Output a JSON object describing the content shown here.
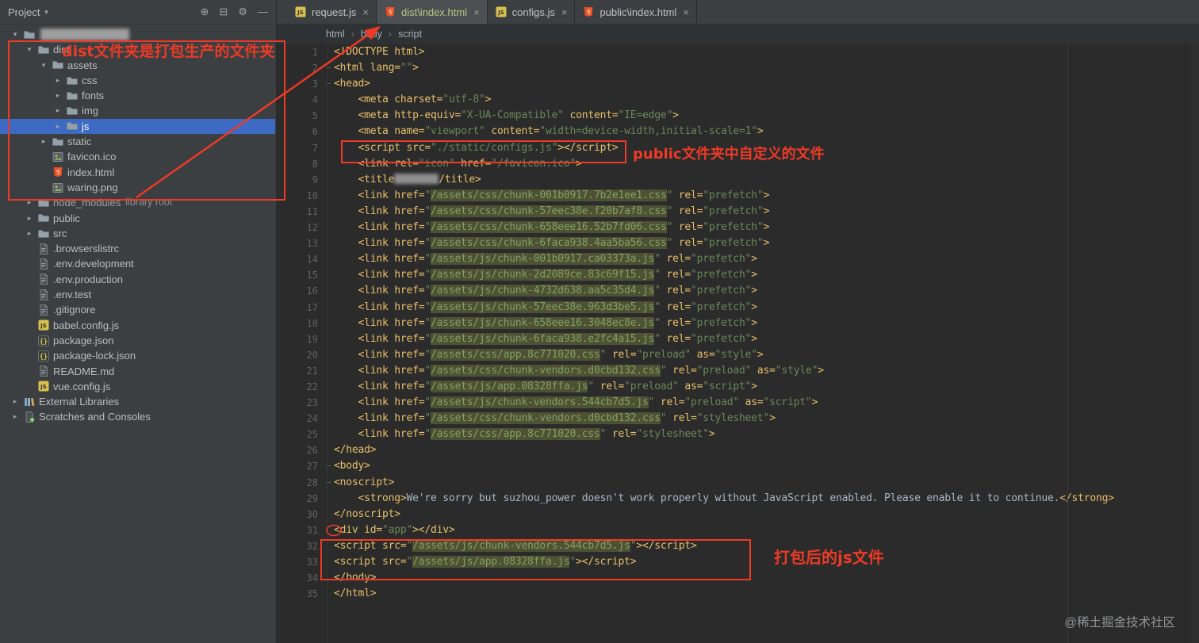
{
  "colors": {
    "annotation_red": "#ee3a26",
    "selection_blue": "#3d6ac2",
    "highlight_olive": "#4e5133",
    "tab_active_label": "#b4c882"
  },
  "project_panel": {
    "title": "Project",
    "title_caret": "▼",
    "toolbar": [
      {
        "name": "locate-file",
        "glyph": "⊕"
      },
      {
        "name": "collapse-all",
        "glyph": "⊟"
      },
      {
        "name": "settings",
        "glyph": "⚙"
      },
      {
        "name": "hide-panel",
        "glyph": "—"
      }
    ],
    "tree": [
      {
        "name": "project-root",
        "label": "",
        "icon": "folder",
        "indent": 0,
        "arrow": "down",
        "censored": true
      },
      {
        "label": "dist",
        "icon": "folder",
        "indent": 1,
        "arrow": "down"
      },
      {
        "label": "assets",
        "icon": "folder",
        "indent": 2,
        "arrow": "down"
      },
      {
        "label": "css",
        "icon": "folder",
        "indent": 3,
        "arrow": "right"
      },
      {
        "label": "fonts",
        "icon": "folder",
        "indent": 3,
        "arrow": "right"
      },
      {
        "label": "img",
        "icon": "folder",
        "indent": 3,
        "arrow": "right"
      },
      {
        "label": "js",
        "icon": "folder",
        "indent": 3,
        "arrow": "right",
        "selected": true
      },
      {
        "label": "static",
        "icon": "folder",
        "indent": 2,
        "arrow": "right"
      },
      {
        "label": "favicon.ico",
        "icon": "image",
        "indent": 2,
        "file": true
      },
      {
        "label": "index.html",
        "icon": "html",
        "indent": 2,
        "file": true
      },
      {
        "label": "waring.png",
        "icon": "image",
        "indent": 2,
        "file": true
      },
      {
        "label": "node_modules",
        "suffix": "library root",
        "icon": "folder",
        "indent": 1,
        "arrow": "right",
        "dim": true
      },
      {
        "label": "public",
        "icon": "folder",
        "indent": 1,
        "arrow": "right"
      },
      {
        "label": "src",
        "icon": "folder",
        "indent": 1,
        "arrow": "right"
      },
      {
        "label": ".browserslistrc",
        "icon": "text",
        "indent": 1,
        "file": true
      },
      {
        "label": ".env.development",
        "icon": "text",
        "indent": 1,
        "file": true
      },
      {
        "label": ".env.production",
        "icon": "text",
        "indent": 1,
        "file": true
      },
      {
        "label": ".env.test",
        "icon": "text",
        "indent": 1,
        "file": true
      },
      {
        "label": ".gitignore",
        "icon": "text",
        "indent": 1,
        "file": true
      },
      {
        "label": "babel.config.js",
        "icon": "js",
        "indent": 1,
        "file": true
      },
      {
        "label": "package.json",
        "icon": "json",
        "indent": 1,
        "file": true
      },
      {
        "label": "package-lock.json",
        "icon": "json",
        "indent": 1,
        "file": true
      },
      {
        "label": "README.md",
        "icon": "text",
        "indent": 1,
        "file": true
      },
      {
        "label": "vue.config.js",
        "icon": "js",
        "indent": 1,
        "file": true
      },
      {
        "label": "External Libraries",
        "icon": "lib",
        "indent": 0,
        "arrow": "right"
      },
      {
        "label": "Scratches and Consoles",
        "icon": "scratch",
        "indent": 0,
        "arrow": "right"
      }
    ]
  },
  "tab_bar": {
    "close_glyph": "×",
    "tabs": [
      {
        "label": "request.js",
        "icon": "js",
        "active": false
      },
      {
        "label": "dist\\index.html",
        "icon": "html",
        "active": true
      },
      {
        "label": "configs.js",
        "icon": "js",
        "active": false
      },
      {
        "label": "public\\index.html",
        "icon": "html",
        "active": false
      }
    ]
  },
  "breadcrumbs": {
    "separator": "›",
    "items": [
      "html",
      "body",
      "script"
    ]
  },
  "editor": {
    "folds": [
      2,
      3,
      27,
      28
    ],
    "lines": [
      [
        {
          "c": "tg",
          "t": "<!DOCTYPE html>"
        }
      ],
      [
        {
          "c": "tg",
          "t": "<html lang="
        },
        {
          "c": "st",
          "t": "\"\""
        },
        {
          "c": "tg",
          "t": ">"
        }
      ],
      [
        {
          "c": "tg",
          "t": "<head>"
        }
      ],
      [
        {
          "c": "tg",
          "t": "    <meta charset="
        },
        {
          "c": "st",
          "t": "\"utf-8\""
        },
        {
          "c": "tg",
          "t": ">"
        }
      ],
      [
        {
          "c": "tg",
          "t": "    <meta http-equiv="
        },
        {
          "c": "st",
          "t": "\"X-UA-Compatible\""
        },
        {
          "c": "tg",
          "t": " content="
        },
        {
          "c": "st",
          "t": "\"IE=edge\""
        },
        {
          "c": "tg",
          "t": ">"
        }
      ],
      [
        {
          "c": "tg",
          "t": "    <meta name="
        },
        {
          "c": "st",
          "t": "\"viewport\""
        },
        {
          "c": "tg",
          "t": " content="
        },
        {
          "c": "st",
          "t": "\"width=device-width,initial-scale=1\""
        },
        {
          "c": "tg",
          "t": ">"
        }
      ],
      [
        {
          "c": "tg",
          "t": "    <script src="
        },
        {
          "c": "st",
          "t": "\"./static/configs.js\""
        },
        {
          "c": "tg",
          "t": "></script>"
        }
      ],
      [
        {
          "c": "tg",
          "t": "    <link rel="
        },
        {
          "c": "st",
          "t": "\"icon\""
        },
        {
          "c": "tg",
          "t": " href="
        },
        {
          "c": "st",
          "t": "\"/favicon.ico\""
        },
        {
          "c": "tg",
          "t": ">"
        }
      ],
      [
        {
          "c": "tg",
          "t": "    <title"
        },
        {
          "c": "cs",
          "t": ""
        },
        {
          "c": "tg",
          "t": "/title>"
        }
      ],
      [
        {
          "c": "tg",
          "t": "    <link href="
        },
        {
          "c": "st",
          "t": "\""
        },
        {
          "c": "hl",
          "t": "/assets/css/chunk-001b0917.7b2e1ee1.css"
        },
        {
          "c": "st",
          "t": "\""
        },
        {
          "c": "tg",
          "t": " rel="
        },
        {
          "c": "st",
          "t": "\"prefetch\""
        },
        {
          "c": "tg",
          "t": ">"
        }
      ],
      [
        {
          "c": "tg",
          "t": "    <link href="
        },
        {
          "c": "st",
          "t": "\""
        },
        {
          "c": "hl",
          "t": "/assets/css/chunk-57eec38e.f20b7af8.css"
        },
        {
          "c": "st",
          "t": "\""
        },
        {
          "c": "tg",
          "t": " rel="
        },
        {
          "c": "st",
          "t": "\"prefetch\""
        },
        {
          "c": "tg",
          "t": ">"
        }
      ],
      [
        {
          "c": "tg",
          "t": "    <link href="
        },
        {
          "c": "st",
          "t": "\""
        },
        {
          "c": "hl",
          "t": "/assets/css/chunk-658eee16.52b7fd06.css"
        },
        {
          "c": "st",
          "t": "\""
        },
        {
          "c": "tg",
          "t": " rel="
        },
        {
          "c": "st",
          "t": "\"prefetch\""
        },
        {
          "c": "tg",
          "t": ">"
        }
      ],
      [
        {
          "c": "tg",
          "t": "    <link href="
        },
        {
          "c": "st",
          "t": "\""
        },
        {
          "c": "hl",
          "t": "/assets/css/chunk-6faca938.4aa5ba56.css"
        },
        {
          "c": "st",
          "t": "\""
        },
        {
          "c": "tg",
          "t": " rel="
        },
        {
          "c": "st",
          "t": "\"prefetch\""
        },
        {
          "c": "tg",
          "t": ">"
        }
      ],
      [
        {
          "c": "tg",
          "t": "    <link href="
        },
        {
          "c": "st",
          "t": "\""
        },
        {
          "c": "hl",
          "t": "/assets/js/chunk-001b0917.ca03373a.js"
        },
        {
          "c": "st",
          "t": "\""
        },
        {
          "c": "tg",
          "t": " rel="
        },
        {
          "c": "st",
          "t": "\"prefetch\""
        },
        {
          "c": "tg",
          "t": ">"
        }
      ],
      [
        {
          "c": "tg",
          "t": "    <link href="
        },
        {
          "c": "st",
          "t": "\""
        },
        {
          "c": "hl",
          "t": "/assets/js/chunk-2d2089ce.83c69f15.js"
        },
        {
          "c": "st",
          "t": "\""
        },
        {
          "c": "tg",
          "t": " rel="
        },
        {
          "c": "st",
          "t": "\"prefetch\""
        },
        {
          "c": "tg",
          "t": ">"
        }
      ],
      [
        {
          "c": "tg",
          "t": "    <link href="
        },
        {
          "c": "st",
          "t": "\""
        },
        {
          "c": "hl",
          "t": "/assets/js/chunk-4732d638.aa5c35d4.js"
        },
        {
          "c": "st",
          "t": "\""
        },
        {
          "c": "tg",
          "t": " rel="
        },
        {
          "c": "st",
          "t": "\"prefetch\""
        },
        {
          "c": "tg",
          "t": ">"
        }
      ],
      [
        {
          "c": "tg",
          "t": "    <link href="
        },
        {
          "c": "st",
          "t": "\""
        },
        {
          "c": "hl",
          "t": "/assets/js/chunk-57eec38e.963d3be5.js"
        },
        {
          "c": "st",
          "t": "\""
        },
        {
          "c": "tg",
          "t": " rel="
        },
        {
          "c": "st",
          "t": "\"prefetch\""
        },
        {
          "c": "tg",
          "t": ">"
        }
      ],
      [
        {
          "c": "tg",
          "t": "    <link href="
        },
        {
          "c": "st",
          "t": "\""
        },
        {
          "c": "hl",
          "t": "/assets/js/chunk-658eee16.3048ec8e.js"
        },
        {
          "c": "st",
          "t": "\""
        },
        {
          "c": "tg",
          "t": " rel="
        },
        {
          "c": "st",
          "t": "\"prefetch\""
        },
        {
          "c": "tg",
          "t": ">"
        }
      ],
      [
        {
          "c": "tg",
          "t": "    <link href="
        },
        {
          "c": "st",
          "t": "\""
        },
        {
          "c": "hl",
          "t": "/assets/js/chunk-6faca938.e2fc4a15.js"
        },
        {
          "c": "st",
          "t": "\""
        },
        {
          "c": "tg",
          "t": " rel="
        },
        {
          "c": "st",
          "t": "\"prefetch\""
        },
        {
          "c": "tg",
          "t": ">"
        }
      ],
      [
        {
          "c": "tg",
          "t": "    <link href="
        },
        {
          "c": "st",
          "t": "\""
        },
        {
          "c": "hl",
          "t": "/assets/css/app.8c771020.css"
        },
        {
          "c": "st",
          "t": "\""
        },
        {
          "c": "tg",
          "t": " rel="
        },
        {
          "c": "st",
          "t": "\"preload\""
        },
        {
          "c": "tg",
          "t": " as="
        },
        {
          "c": "st",
          "t": "\"style\""
        },
        {
          "c": "tg",
          "t": ">"
        }
      ],
      [
        {
          "c": "tg",
          "t": "    <link href="
        },
        {
          "c": "st",
          "t": "\""
        },
        {
          "c": "hl",
          "t": "/assets/css/chunk-vendors.d0cbd132.css"
        },
        {
          "c": "st",
          "t": "\""
        },
        {
          "c": "tg",
          "t": " rel="
        },
        {
          "c": "st",
          "t": "\"preload\""
        },
        {
          "c": "tg",
          "t": " as="
        },
        {
          "c": "st",
          "t": "\"style\""
        },
        {
          "c": "tg",
          "t": ">"
        }
      ],
      [
        {
          "c": "tg",
          "t": "    <link href="
        },
        {
          "c": "st",
          "t": "\""
        },
        {
          "c": "hl",
          "t": "/assets/js/app.08328ffa.js"
        },
        {
          "c": "st",
          "t": "\""
        },
        {
          "c": "tg",
          "t": " rel="
        },
        {
          "c": "st",
          "t": "\"preload\""
        },
        {
          "c": "tg",
          "t": " as="
        },
        {
          "c": "st",
          "t": "\"script\""
        },
        {
          "c": "tg",
          "t": ">"
        }
      ],
      [
        {
          "c": "tg",
          "t": "    <link href="
        },
        {
          "c": "st",
          "t": "\""
        },
        {
          "c": "hl",
          "t": "/assets/js/chunk-vendors.544cb7d5.js"
        },
        {
          "c": "st",
          "t": "\""
        },
        {
          "c": "tg",
          "t": " rel="
        },
        {
          "c": "st",
          "t": "\"preload\""
        },
        {
          "c": "tg",
          "t": " as="
        },
        {
          "c": "st",
          "t": "\"script\""
        },
        {
          "c": "tg",
          "t": ">"
        }
      ],
      [
        {
          "c": "tg",
          "t": "    <link href="
        },
        {
          "c": "st",
          "t": "\""
        },
        {
          "c": "hl",
          "t": "/assets/css/chunk-vendors.d0cbd132.css"
        },
        {
          "c": "st",
          "t": "\""
        },
        {
          "c": "tg",
          "t": " rel="
        },
        {
          "c": "st",
          "t": "\"stylesheet\""
        },
        {
          "c": "tg",
          "t": ">"
        }
      ],
      [
        {
          "c": "tg",
          "t": "    <link href="
        },
        {
          "c": "st",
          "t": "\""
        },
        {
          "c": "hl",
          "t": "/assets/css/app.8c771020.css"
        },
        {
          "c": "st",
          "t": "\""
        },
        {
          "c": "tg",
          "t": " rel="
        },
        {
          "c": "st",
          "t": "\"stylesheet\""
        },
        {
          "c": "tg",
          "t": ">"
        }
      ],
      [
        {
          "c": "tg",
          "t": "</head>"
        }
      ],
      [
        {
          "c": "tg",
          "t": "<body>"
        }
      ],
      [
        {
          "c": "tg",
          "t": "<noscript>"
        }
      ],
      [
        {
          "c": "tg",
          "t": "    <strong>"
        },
        {
          "c": "tx",
          "t": "We're sorry but suzhou_power doesn't work properly without JavaScript enabled. Please enable it to continue."
        },
        {
          "c": "tg",
          "t": "</strong>"
        }
      ],
      [
        {
          "c": "tg",
          "t": "</noscript>"
        }
      ],
      [
        {
          "c": "tg",
          "t": "<div id="
        },
        {
          "c": "st",
          "t": "\"app\""
        },
        {
          "c": "tg",
          "t": "></div>"
        }
      ],
      [
        {
          "c": "tg",
          "t": "<script src="
        },
        {
          "c": "st",
          "t": "\""
        },
        {
          "c": "hl",
          "t": "/assets/js/chunk-vendors.544cb7d5.js"
        },
        {
          "c": "st",
          "t": "\""
        },
        {
          "c": "tg",
          "t": "></script>"
        }
      ],
      [
        {
          "c": "tg",
          "t": "<script src="
        },
        {
          "c": "st",
          "t": "\""
        },
        {
          "c": "hl",
          "t": "/assets/js/app.08328ffa.js"
        },
        {
          "c": "st",
          "t": "\""
        },
        {
          "c": "tg",
          "t": "></script>"
        }
      ],
      [
        {
          "c": "tg",
          "t": "</body>"
        }
      ],
      [
        {
          "c": "tg",
          "t": "</html>"
        }
      ]
    ]
  },
  "annotations": {
    "tree_box_note": "dist文件夹是打包生产的文件夹",
    "configs_note": "public文件夹中自定义的文件",
    "scripts_note": "打包后的js文件"
  },
  "watermark": "@稀土掘金技术社区"
}
